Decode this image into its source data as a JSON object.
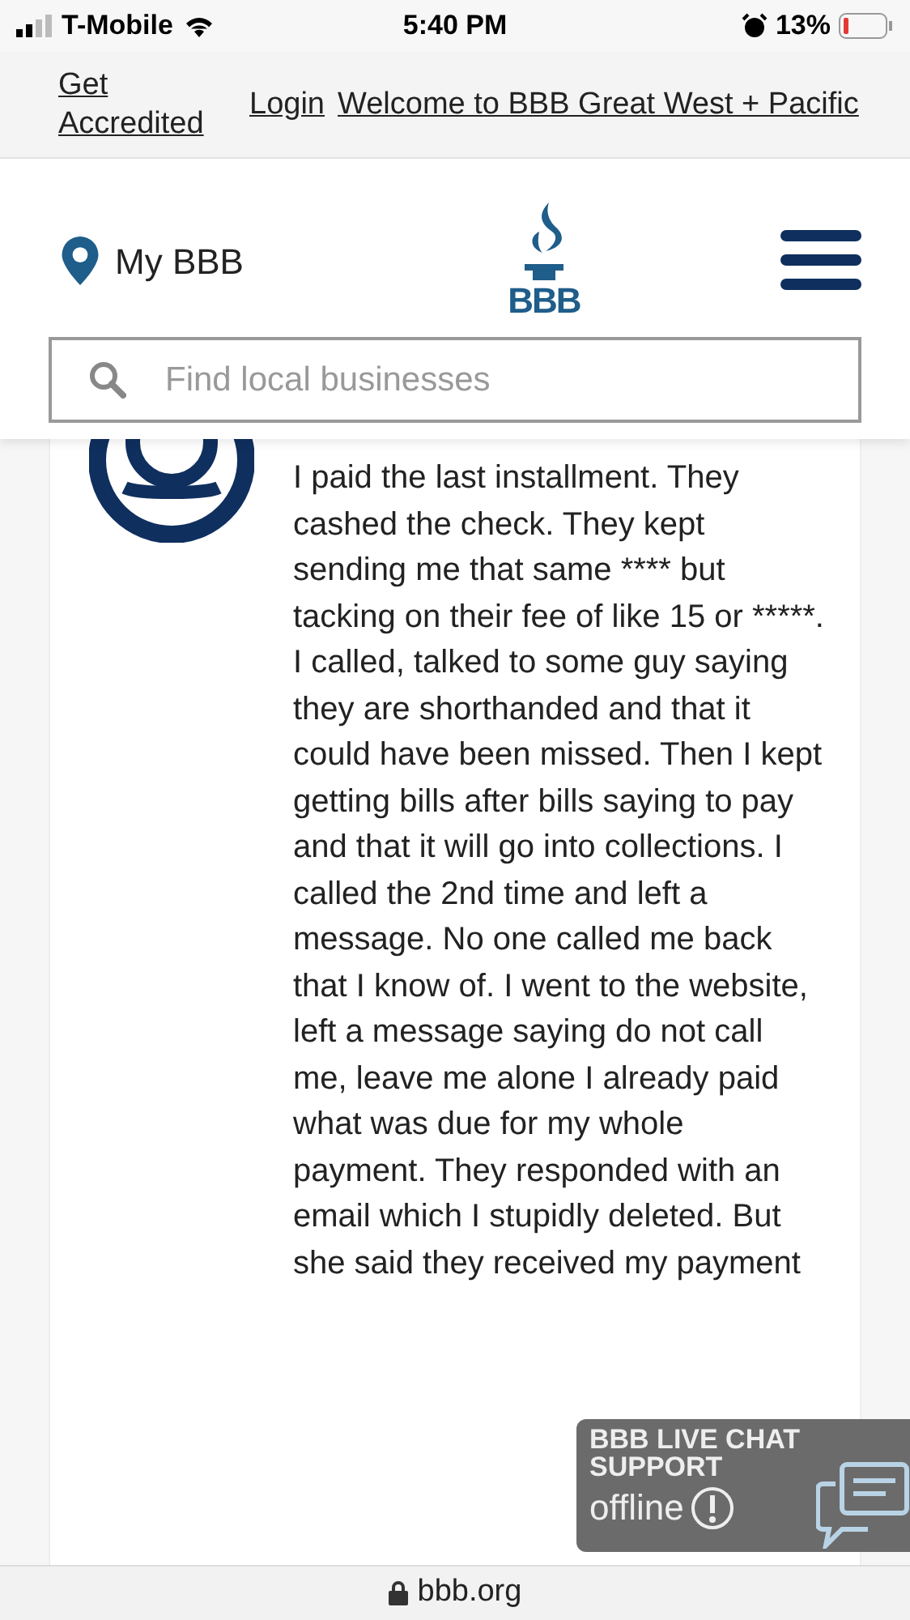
{
  "status_bar": {
    "carrier": "T-Mobile",
    "time": "5:40 PM",
    "battery": "13%"
  },
  "top_links": [
    {
      "label": "Get Accredited"
    },
    {
      "label": "Login"
    },
    {
      "label": "Welcome to BBB Great West + Pacific"
    }
  ],
  "header": {
    "my_bbb": "My BBB",
    "logo": "BBB",
    "search": {
      "placeholder": "Find local businesses"
    }
  },
  "review": {
    "text": "I paid the last installment. They cashed the check. They kept sending me that same **** but tacking on their fee of like 15 or *****. I called, talked to some guy saying they are shorthanded and that it could have been missed. Then I kept getting bills after bills saying to pay and that it will go into collections. I called the 2nd time and left a message. No one called me back that I know of. I went to the website, left a message saying do not call me, leave me alone I already paid what was due for my whole payment. They responded with an email which I stupidly deleted. But she said they received my payment"
  },
  "chat_widget": {
    "title": "BBB LIVE CHAT SUPPORT",
    "status": "offline"
  },
  "url_bar": {
    "domain": "bbb.org"
  }
}
